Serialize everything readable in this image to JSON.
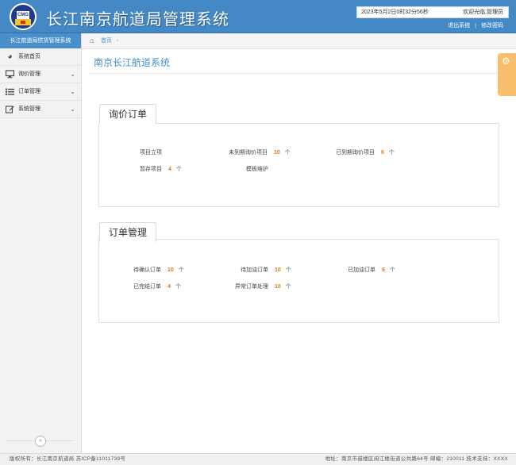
{
  "header": {
    "logo_text": "CMG",
    "title": "长江南京航道局管理系统",
    "datetime": "2023年5月2日0时32分56秒",
    "welcome": "欢迎光临,管理员",
    "logout": "退出系统",
    "separator": "|",
    "change_password": "修改密码"
  },
  "sidebar": {
    "title": "长江航道局供货管理系统",
    "items": [
      {
        "label": "系统首页",
        "icon": "dashboard-icon",
        "has_chevron": false
      },
      {
        "label": "询价管理",
        "icon": "monitor-icon",
        "has_chevron": true
      },
      {
        "label": "订单管理",
        "icon": "list-icon",
        "has_chevron": true
      },
      {
        "label": "系统管理",
        "icon": "edit-icon",
        "has_chevron": true
      }
    ],
    "collapse_icon": "collapse-left-icon"
  },
  "breadcrumb": {
    "home": "首页",
    "separator": "›"
  },
  "main": {
    "page_title": "南京长江航道系统",
    "inquiry_panel": {
      "tab": "询价订单",
      "rows": [
        [
          {
            "label": "项目立项",
            "value": "",
            "unit": ""
          },
          {
            "label": "未到期询价项目",
            "value": "10",
            "unit": "个"
          },
          {
            "label": "已到期询价项目",
            "value": "6",
            "unit": "个"
          }
        ],
        [
          {
            "label": "暂存项目",
            "value": "4",
            "unit": "个"
          },
          {
            "label": "模板维护",
            "value": "",
            "unit": ""
          }
        ]
      ]
    },
    "order_panel": {
      "tab": "订单管理",
      "rows": [
        [
          {
            "label": "待确认订单",
            "value": "10",
            "unit": "个"
          },
          {
            "label": "待加油订单",
            "value": "10",
            "unit": "个"
          },
          {
            "label": "已加油订单",
            "value": "6",
            "unit": "个"
          }
        ],
        [
          {
            "label": "已完结订单",
            "value": "4",
            "unit": "个"
          },
          {
            "label": "异常订单处理",
            "value": "10",
            "unit": "个"
          }
        ]
      ]
    }
  },
  "footer": {
    "left": "版权所有：长江南京航道局 苏ICP备11011739号",
    "right": "地址：南京市鼓楼区阅江楼街道公共路64号 邮编：210011 技术支持：XXXX"
  },
  "colors": {
    "header_bg": "#4489c5",
    "accent": "#4a8fc9",
    "number": "#e07b1c",
    "settings_tab": "#f8be6b"
  }
}
